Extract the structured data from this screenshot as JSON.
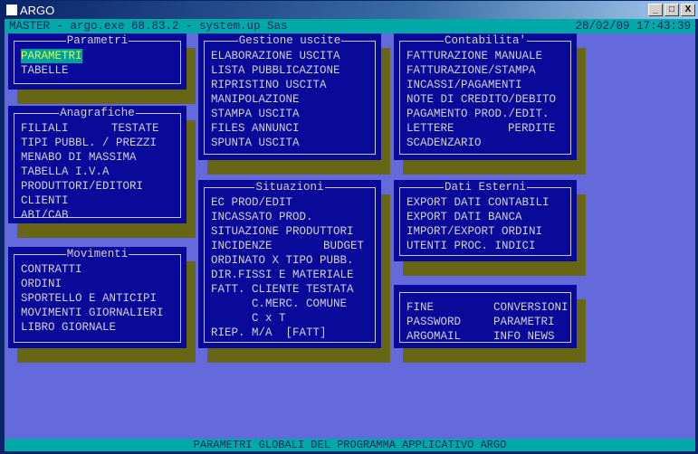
{
  "window": {
    "title": "ARGO",
    "buttons": [
      "_",
      "□",
      "X"
    ]
  },
  "header": {
    "left": "MASTER - argo.exe 68.83.2 - system.up Sas",
    "right": "28/02/09 17:43:39"
  },
  "status": "PARAMETRI GLOBALI DEL PROGRAMMA APPLICATIVO ARGO",
  "colors": {
    "screen": "#3c3cc0",
    "panel": "#0a0a9a",
    "teal": "#00a8a8",
    "shadow": "#3a3a00"
  },
  "panels": [
    {
      "id": "parametri",
      "title": "Parametri",
      "rows": [
        [
          "PARAMETRI"
        ],
        [
          "TABELLE"
        ]
      ],
      "selected": "PARAMETRI"
    },
    {
      "id": "anagrafiche",
      "title": "Anagrafiche",
      "rows": [
        [
          "FILIALI",
          "TESTATE"
        ],
        [
          "TIPI PUBBL. / PREZZI"
        ],
        [
          "MENABO DI MASSIMA"
        ],
        [
          "TABELLA I.V.A"
        ],
        [
          "PRODUTTORI/EDITORI"
        ],
        [
          "CLIENTI"
        ],
        [
          "ABI/CAB"
        ]
      ]
    },
    {
      "id": "movimenti",
      "title": "Movimenti",
      "rows": [
        [
          "CONTRATTI"
        ],
        [
          "ORDINI"
        ],
        [
          "SPORTELLO E ANTICIPI"
        ],
        [
          "MOVIMENTI GIORNALIERI"
        ],
        [
          "LIBRO GIORNALE"
        ]
      ]
    },
    {
      "id": "gestione-uscite",
      "title": "Gestione uscite",
      "rows": [
        [
          "ELABORAZIONE USCITA"
        ],
        [
          "LISTA PUBBLICAZIONE"
        ],
        [
          "RIPRISTINO USCITA"
        ],
        [
          "MANIPOLAZIONE"
        ],
        [
          "STAMPA USCITA"
        ],
        [
          "FILES ANNUNCI"
        ],
        [
          "SPUNTA USCITA"
        ]
      ]
    },
    {
      "id": "situazioni",
      "title": "Situazioni",
      "rows": [
        [
          "EC PROD/EDIT"
        ],
        [
          "INCASSATO PROD."
        ],
        [
          "SITUAZIONE PRODUTTORI"
        ],
        [
          "INCIDENZE",
          "BUDGET"
        ],
        [
          "ORDINATO X TIPO PUBB."
        ],
        [
          "DIR.FISSI E MATERIALE"
        ],
        [
          "FATT. CLIENTE TESTATA"
        ],
        [
          "      C.MERC. COMUNE"
        ],
        [
          "      C x T"
        ],
        [
          "RIEP. M/A  [FATT]"
        ]
      ]
    },
    {
      "id": "contabilita",
      "title": "Contabilita'",
      "rows": [
        [
          "FATTURAZIONE MANUALE"
        ],
        [
          "FATTURAZIONE/STAMPA"
        ],
        [
          "INCASSI/PAGAMENTI"
        ],
        [
          "NOTE DI CREDITO/DEBITO"
        ],
        [
          "PAGAMENTO PROD./EDIT."
        ],
        [
          "LETTERE",
          "PERDITE"
        ],
        [
          "SCADENZARIO"
        ]
      ]
    },
    {
      "id": "dati-esterni",
      "title": "Dati Esterni",
      "rows": [
        [
          "EXPORT DATI CONTABILI"
        ],
        [
          "EXPORT DATI BANCA"
        ],
        [
          "IMPORT/EXPORT ORDINI"
        ],
        [
          "UTENTI PROC. INDICI"
        ]
      ]
    },
    {
      "id": "utility",
      "title": "",
      "rows": [
        [
          "FINE",
          "CONVERSIONI"
        ],
        [
          "PASSWORD",
          "PARAMETRI"
        ],
        [
          "ARGOMAIL",
          "INFO NEWS"
        ]
      ]
    }
  ]
}
